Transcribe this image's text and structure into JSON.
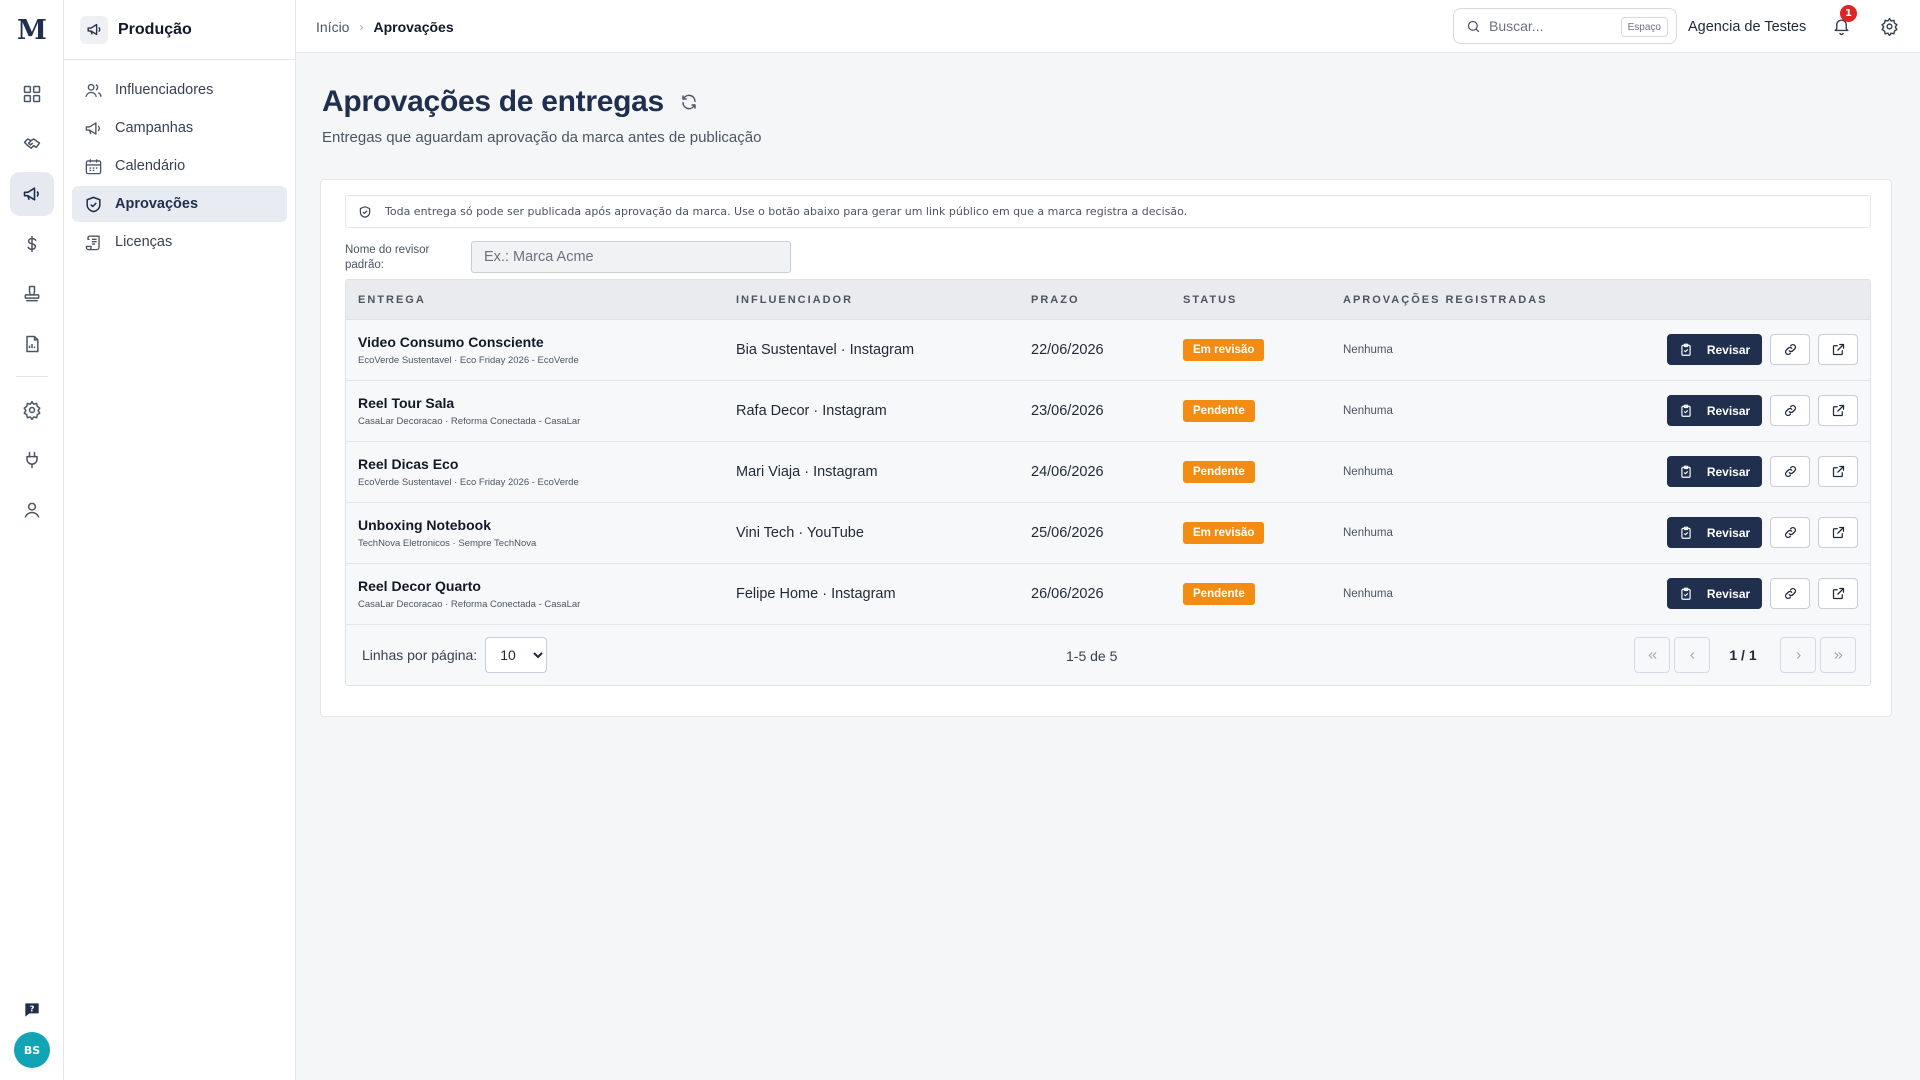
{
  "rail": {
    "logo": "M",
    "items": [
      {
        "icon": "dashboard-icon",
        "active": false
      },
      {
        "icon": "handshake-icon",
        "active": false
      },
      {
        "icon": "megaphone-icon",
        "active": true
      },
      {
        "icon": "dollar-icon",
        "active": false
      },
      {
        "icon": "stamp-icon",
        "active": false
      },
      {
        "icon": "report-icon",
        "active": false
      },
      {
        "icon": "settings-icon",
        "active": false
      },
      {
        "icon": "plug-icon",
        "active": false
      },
      {
        "icon": "user-icon",
        "active": false
      }
    ],
    "avatar": "BS"
  },
  "sidebar": {
    "title": "Produção",
    "items": [
      {
        "label": "Influenciadores",
        "icon": "users-icon"
      },
      {
        "label": "Campanhas",
        "icon": "megaphone-icon"
      },
      {
        "label": "Calendário",
        "icon": "calendar-icon"
      },
      {
        "label": "Aprovações",
        "icon": "shield-check-icon",
        "active": true
      },
      {
        "label": "Licenças",
        "icon": "scroll-icon"
      }
    ]
  },
  "topbar": {
    "breadcrumb": [
      "Início",
      "Aprovações"
    ],
    "search_placeholder": "Buscar...",
    "search_hint": "Espaço",
    "org_name": "Agencia de Testes",
    "notifications": "1"
  },
  "page": {
    "title": "Aprovações de entregas",
    "subtitle": "Entregas que aguardam aprovação da marca antes de publicação",
    "notice": "Toda entrega só pode ser publicada após aprovação da marca. Use o botão abaixo para gerar um link público em que a marca registra a decisão.",
    "reviewer_label": "Nome do revisor padrão:",
    "reviewer_placeholder": "Ex.: Marca Acme"
  },
  "table": {
    "columns": [
      "ENTREGA",
      "INFLUENCIADOR",
      "PRAZO",
      "STATUS",
      "APROVAÇÕES REGISTRADAS"
    ],
    "rows": [
      {
        "title": "Video Consumo Consciente",
        "sub": "EcoVerde Sustentavel · Eco Friday 2026 - EcoVerde",
        "influencer": "Bia Sustentavel · Instagram",
        "deadline": "22/06/2026",
        "status": "Em revisão",
        "approvals": "Nenhuma"
      },
      {
        "title": "Reel Tour Sala",
        "sub": "CasaLar Decoracao · Reforma Conectada - CasaLar",
        "influencer": "Rafa Decor · Instagram",
        "deadline": "23/06/2026",
        "status": "Pendente",
        "approvals": "Nenhuma"
      },
      {
        "title": "Reel Dicas Eco",
        "sub": "EcoVerde Sustentavel · Eco Friday 2026 - EcoVerde",
        "influencer": "Mari Viaja · Instagram",
        "deadline": "24/06/2026",
        "status": "Pendente",
        "approvals": "Nenhuma"
      },
      {
        "title": "Unboxing Notebook",
        "sub": "TechNova Eletronicos · Sempre TechNova",
        "influencer": "Vini Tech · YouTube",
        "deadline": "25/06/2026",
        "status": "Em revisão",
        "approvals": "Nenhuma"
      },
      {
        "title": "Reel Decor Quarto",
        "sub": "CasaLar Decoracao · Reforma Conectada - CasaLar",
        "influencer": "Felipe Home · Instagram",
        "deadline": "26/06/2026",
        "status": "Pendente",
        "approvals": "Nenhuma"
      }
    ],
    "review_label": "Revisar",
    "rows_per_page_label": "Linhas por página:",
    "rows_per_page": "10",
    "range": "1-5 de 5",
    "page": "1 / 1"
  },
  "colors": {
    "primary": "#1f2f4d",
    "status": "#f28c13",
    "badge": "#dc2626"
  }
}
